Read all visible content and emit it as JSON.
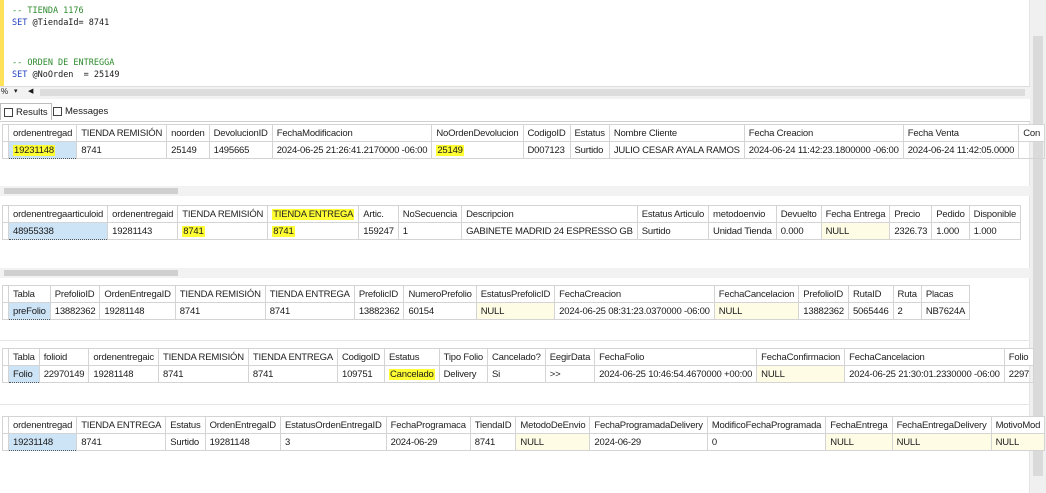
{
  "editor": {
    "lines": [
      {
        "text": "-- TIENDA 1176",
        "kind": "comment"
      },
      {
        "text": "SET @TiendaId= 8741",
        "kind": "code"
      },
      {
        "text": "",
        "kind": "code"
      },
      {
        "text": "",
        "kind": "code"
      },
      {
        "text": "-- ORDEN DE ENTREGGA",
        "kind": "comment"
      },
      {
        "text": "SET @NoOrden  = 25149",
        "kind": "code"
      }
    ]
  },
  "zoom": "%",
  "tabs": {
    "results": "Results",
    "messages": "Messages"
  },
  "grid1": {
    "headers": [
      "ordenentregad",
      "TIENDA REMISIÓN",
      "noorden",
      "DevolucionID",
      "FechaModificacion",
      "NoOrdenDevolucion",
      "CodigoID",
      "Estatus",
      "Nombre Cliente",
      "Fecha Creacion",
      "Fecha Venta",
      "Con"
    ],
    "rows": [
      [
        "19231148",
        "8741",
        "25149",
        "1495665",
        "2024-06-25 21:26:41.2170000 -06:00",
        "25149",
        "D007123",
        "Surtido",
        "JULIO CESAR AYALA RAMOS",
        "2024-06-24 11:42:23.1800000 -06:00",
        "2024-06-24 11:42:05.0000",
        ""
      ]
    ]
  },
  "grid2": {
    "headers": [
      "ordenentregaarticuloid",
      "ordenentregaid",
      "TIENDA REMISIÓN",
      "TIENDA ENTREGA",
      "Artic.",
      "NoSecuencia",
      "Descripcion",
      "Estatus Articulo",
      "metodoenvio",
      "Devuelto",
      "Fecha Entrega",
      "Precio",
      "Pedido",
      "Disponible"
    ],
    "rows": [
      [
        "48955338",
        "19281143",
        "8741",
        "8741",
        "159247",
        "1",
        "GABINETE MADRID 24 ESPRESSO GB",
        "Surtido",
        "Unidad Tienda",
        "0.000",
        "NULL",
        "2326.73",
        "1.000",
        "1.000"
      ]
    ]
  },
  "grid3": {
    "headers": [
      "Tabla",
      "PrefolioID",
      "OrdenEntregaID",
      "TIENDA REMISIÓN",
      "TIENDA ENTREGA",
      "PrefolicID",
      "NumeroPrefolio",
      "EstatusPrefolicID",
      "FechaCreacion",
      "FechaCancelacion",
      "PrefolioID",
      "RutaID",
      "Ruta",
      "Placas"
    ],
    "rows": [
      [
        "preFolio",
        "13882362",
        "19281148",
        "8741",
        "8741",
        "13882362",
        "60154",
        "NULL",
        "2024-06-25 08:31:23.0370000 -06:00",
        "NULL",
        "13882362",
        "5065446",
        "2",
        "NB7624A"
      ]
    ]
  },
  "grid4": {
    "headers": [
      "Tabla",
      "folioid",
      "ordenentregaic",
      "TIENDA REMISIÓN",
      "TIENDA ENTREGA",
      "CodigoID",
      "Estatus",
      "Tipo Folio",
      "Cancelado?",
      "EegirData",
      "FechaFolio",
      "FechaConfirmacion",
      "FechaCancelacion",
      "Folio"
    ],
    "rows": [
      [
        "Folio",
        "22970149",
        "19281148",
        "8741",
        "8741",
        "109751",
        "Cancelado",
        "Delivery",
        "Si",
        ">>",
        "2024-06-25 10:46:54.4670000 +00:00",
        "NULL",
        "2024-06-25 21:30:01.2330000 -06:00",
        "2297"
      ]
    ]
  },
  "grid5": {
    "headers": [
      "ordenentregad",
      "TIENDA ENTREGA",
      "Estatus",
      "OrdenEntregaID",
      "EstatusOrdenEntregaID",
      "FechaProgramaca",
      "TiendaID",
      "MetodoDeEnvio",
      "FechaProgramadaDelivery",
      "ModificoFechaProgramada",
      "FechaEntrega",
      "FechaEntregaDelivery",
      "MotivoMod"
    ],
    "rows": [
      [
        "19231148",
        "8741",
        "Surtido",
        "19281148",
        "3",
        "2024-06-29",
        "8741",
        "NULL",
        "2024-06-29",
        "0",
        "NULL",
        "NULL",
        "NULL"
      ]
    ]
  }
}
